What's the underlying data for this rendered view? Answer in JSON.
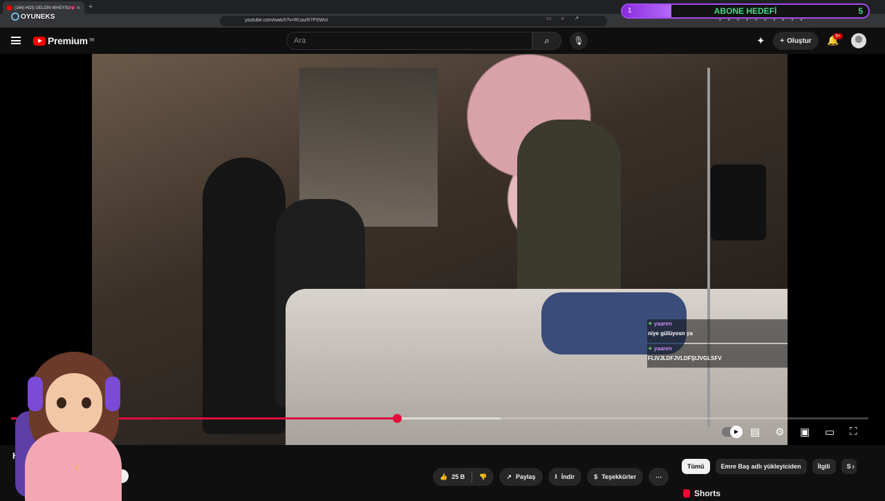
{
  "browser": {
    "tab_title": "(164) HOŞ GELDİN WHEYSU💗",
    "new_tab": "+",
    "tab_close": "×",
    "url": "youtube.com/watch?v=RUazR7PSWnI"
  },
  "overlay": {
    "logo_text": "OYUNEKS",
    "abone": {
      "title": "ABONE HEDEFİ",
      "left_value": "1",
      "right_value": "5",
      "progress_fraction": 0.2,
      "color": "#a44cf0"
    }
  },
  "header": {
    "brand": "Premium",
    "region": "TR",
    "search_placeholder": "Ara",
    "create_label": "Oluştur",
    "notification_badge": "9+",
    "search_icon": "search-icon",
    "mic_icon": "mic-icon"
  },
  "video": {
    "chat": [
      {
        "user": "yaaren",
        "message": "niye gülüyosn ya"
      },
      {
        "user": "yaaren",
        "message": "FLIVJLDFJVLDFŞIJVGLSFV"
      }
    ],
    "progress": {
      "played_fraction": 0.45,
      "buffered_fraction": 0.571,
      "played_color": "#e40d3c"
    }
  },
  "below": {
    "title_visible": "H",
    "like_count": "25 B",
    "share_label": "Paylaş",
    "download_label": "İndir",
    "thanks_label": "Teşekkürler",
    "more_label": "⋯",
    "chips": [
      "Tümü",
      "Emre Baş adlı yükleyiciden",
      "İlgili",
      "S"
    ],
    "shorts_label": "Shorts"
  }
}
